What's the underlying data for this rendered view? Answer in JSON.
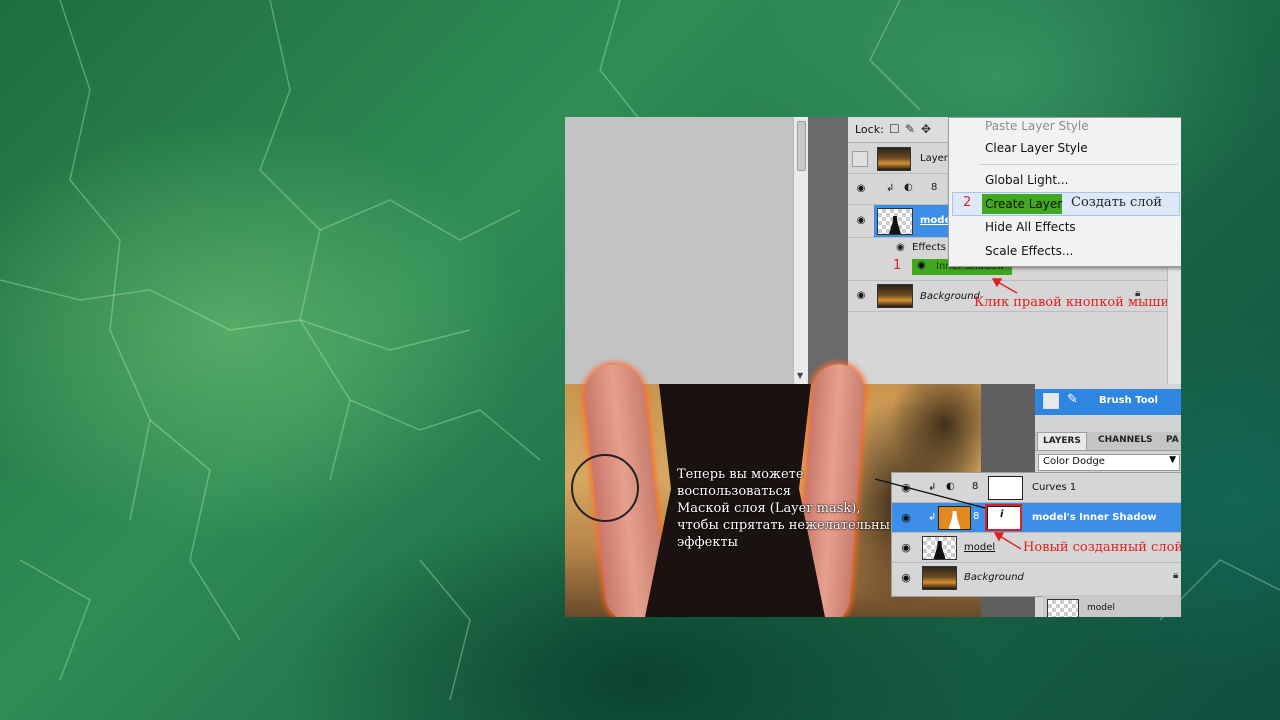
{
  "colors": {
    "accent_green": "#3fa81f",
    "highlight_blue": "#3d8ee6",
    "annotation_red": "#e01e1e"
  },
  "top_panel": {
    "lock_label": "Lock:",
    "layer_row_label": "Layer",
    "selected_layer_label": "mode",
    "effects_label": "Effects",
    "inner_shadow_label": "Inner Shadow",
    "background_label": "Background",
    "step1_number": "1",
    "step1_note": "Клик правой кнопкой мыши",
    "context_menu": {
      "items": [
        {
          "label": "Paste Layer Style",
          "disabled": true
        },
        {
          "label": "Clear Layer Style"
        },
        {
          "label": "Global Light..."
        },
        {
          "label": "Create Layer",
          "highlighted": true
        },
        {
          "label": "Hide All Effects"
        },
        {
          "label": "Scale Effects..."
        }
      ],
      "step2_number": "2",
      "step2_note": "Создать слой"
    }
  },
  "bottom_panel": {
    "instruction_lines": [
      "Теперь вы можете",
      "воспользоваться",
      "Маской слоя (Layer mask),",
      "чтобы спрятать нежелательные",
      "эффекты"
    ],
    "tool_label": "Brush Tool",
    "tabs": [
      {
        "label": "LAYERS",
        "active": true
      },
      {
        "label": "CHANNELS"
      },
      {
        "label": "PA"
      }
    ],
    "blend_mode": "Color Dodge",
    "layers": [
      {
        "name": "Curves 1"
      },
      {
        "name": "model's Inner Shadow",
        "selected": true
      },
      {
        "name": "model"
      },
      {
        "name": "Background"
      }
    ],
    "new_layer_note": "Новый созданный слой",
    "partial_layer_label": "model"
  }
}
